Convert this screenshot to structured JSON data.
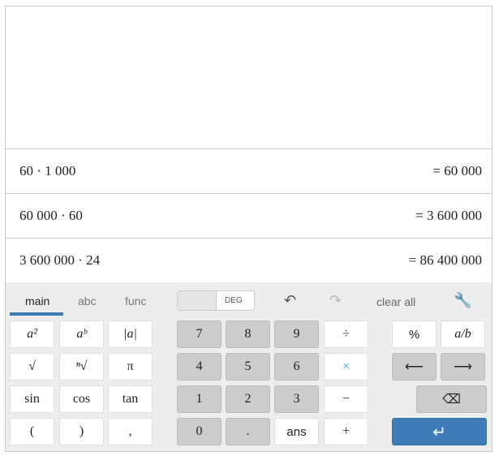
{
  "history": [
    {
      "expr": "60 · 1 000",
      "result": "= 60 000"
    },
    {
      "expr": "60 000 · 60",
      "result": "= 3 600 000"
    },
    {
      "expr": "3 600 000 · 24",
      "result": "= 86 400 000"
    }
  ],
  "tabs": [
    "main",
    "abc",
    "func"
  ],
  "toggle": {
    "label": "DEG"
  },
  "toolbar": {
    "clear_all": "clear all"
  },
  "keys": {
    "left": [
      "a²",
      "aᵇ",
      "|a|",
      "√",
      "ⁿ√",
      "π",
      "sin",
      "cos",
      "tan",
      "(",
      ")",
      ","
    ],
    "mid": [
      "7",
      "8",
      "9",
      "÷",
      "4",
      "5",
      "6",
      "×",
      "1",
      "2",
      "3",
      "−",
      "0",
      ".",
      "ans",
      "+"
    ],
    "right": {
      "percent": "%",
      "fraction": "a/b",
      "left": "⟵",
      "right": "⟶",
      "backspace": "⌫",
      "enter": "↵"
    }
  },
  "colors": {
    "accent": "#3f7bb8",
    "times": "#3f9ad8"
  }
}
